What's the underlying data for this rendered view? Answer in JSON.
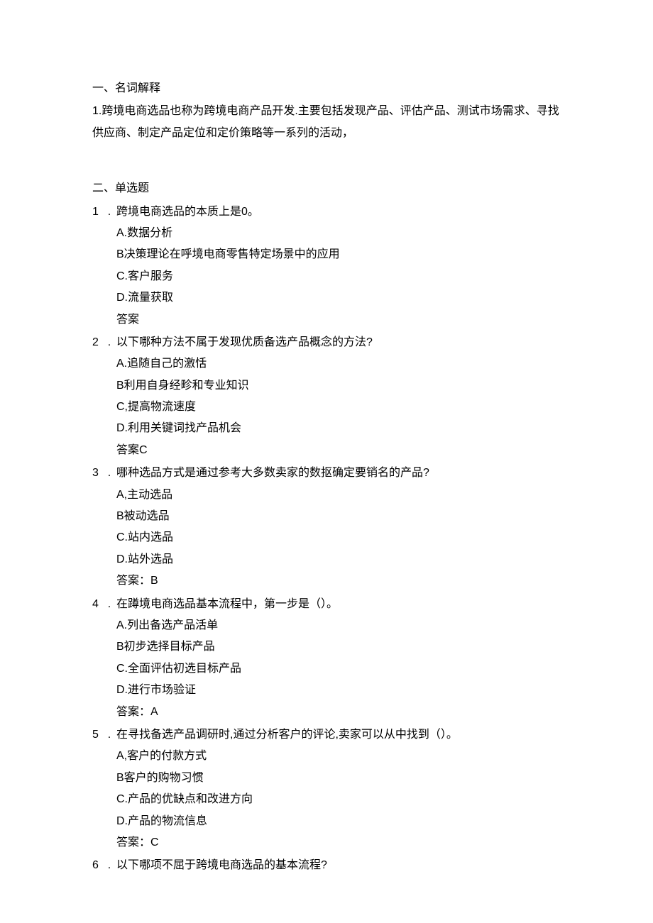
{
  "section1": {
    "title": "一、名词解释",
    "definition": "1.跨境电商选品也称为跨境电商产品开发.主要包括发现产品、评估产品、测试市场需求、寻找供应商、制定产品定位和定价策略等一系列的活动，"
  },
  "section2": {
    "title": "二、单选题",
    "questions": [
      {
        "number": "1",
        "dot": ".",
        "text": "跨境电商选品的本质上是0。",
        "options": [
          "A.数据分析",
          "B决策理论在呼境电商零售特定场景中的应用",
          "C.客户服务",
          "D.流量获取"
        ],
        "answer": "答案"
      },
      {
        "number": "2",
        "dot": ".",
        "text": "以下哪种方法不属于发现优质备选产品概念的方法?",
        "options": [
          "A.追随自己的激恬",
          "B利用自身经畛和专业知识",
          "C,提高物流速度",
          "D.利用关键词找产品机会"
        ],
        "answer": "答案C"
      },
      {
        "number": "3",
        "dot": ".",
        "text": "哪种选品方式是通过参考大多数卖家的数抠确定要销名的产品?",
        "options": [
          "A,主动选品",
          "B被动选品",
          "C.站内选品",
          "D.站外选品"
        ],
        "answer": "答案：B"
      },
      {
        "number": "4",
        "dot": ".",
        "text": "在蹲境电商选品基本流程中，第一步是（）。",
        "options": [
          "A.列出备选产品活单",
          "B初步选择目标产品",
          "C.全面评估初选目标产品",
          "D.进行市场验证"
        ],
        "answer": "答案：A"
      },
      {
        "number": "5",
        "dot": ".",
        "text": "在寻找备选产品调研时,通过分析客户的评论,卖家可以从中找到（）。",
        "options": [
          "A,客户的付款方式",
          "B客户的购物习惯",
          "C.产品的优缺点和改进方向",
          "D.产品的物流信息"
        ],
        "answer": "答案：C"
      },
      {
        "number": "6",
        "dot": ".",
        "text": "以下哪项不屈于跨境电商选品的基本流程?",
        "options": [],
        "answer": ""
      }
    ]
  }
}
